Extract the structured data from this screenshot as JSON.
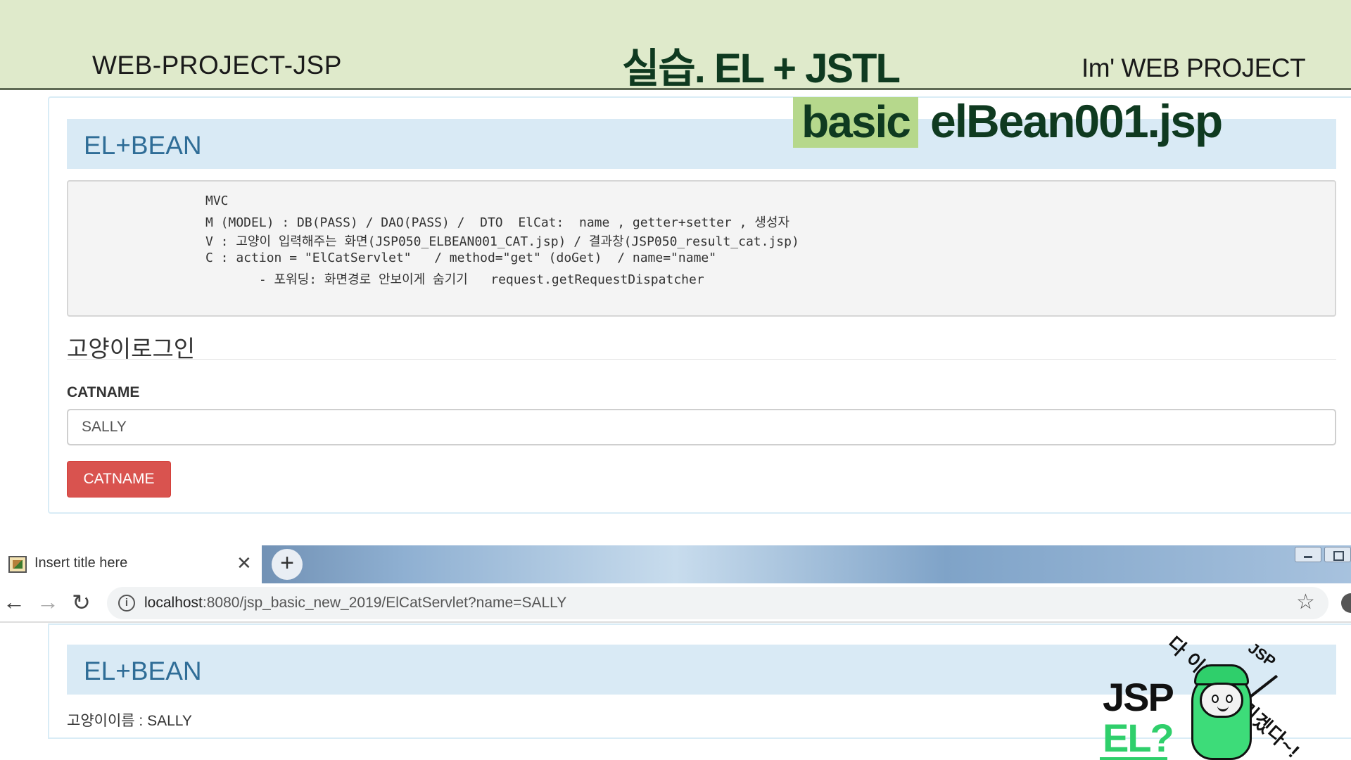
{
  "slide": {
    "header_left": "WEB-PROJECT-JSP",
    "header_center": "실습. EL + JSTL",
    "header_right": "Im'  WEB PROJECT",
    "tag_label": "basic",
    "file_name": "elBean001.jsp",
    "header_bg_color": "#dfeacb",
    "tag_color": "#b6d88c"
  },
  "top_panel": {
    "heading": "EL+BEAN",
    "code_lines": [
      "MVC",
      "M (MODEL) : DB(PASS) / DAO(PASS) /  DTO  ElCat:  name , getter+setter , 생성자",
      "V : 고양이 입력해주는 화면(JSP050_ELBEAN001_CAT.jsp) / 결과창(JSP050_result_cat.jsp)",
      "C : action = \"ElCatServlet\"   / method=\"get\" (doGet)  / name=\"name\"",
      "       - 포워딩: 화면경로 안보이게 숨기기   request.getRequestDispatcher"
    ],
    "legend": "고양이로그인",
    "field_label": "CATNAME",
    "field_value": "SALLY",
    "button_label": "CATNAME",
    "button_color": "#d9534f"
  },
  "browser": {
    "tab_title": "Insert title here",
    "tab_close_icon": "close-icon",
    "new_tab_icon": "plus-icon",
    "url_host": "localhost",
    "url_rest": ":8080/jsp_basic_new_2019/ElCatServlet?name=SALLY"
  },
  "bottom_panel": {
    "heading": "EL+BEAN",
    "result": "고양이이름 : SALLY"
  },
  "mascot": {
    "label_jsp": "JSP",
    "label_el": "EL?",
    "caption": "다 이해해버리겠다~!",
    "caption_tag": "JSP",
    "accent_color": "#2fcf6b"
  }
}
